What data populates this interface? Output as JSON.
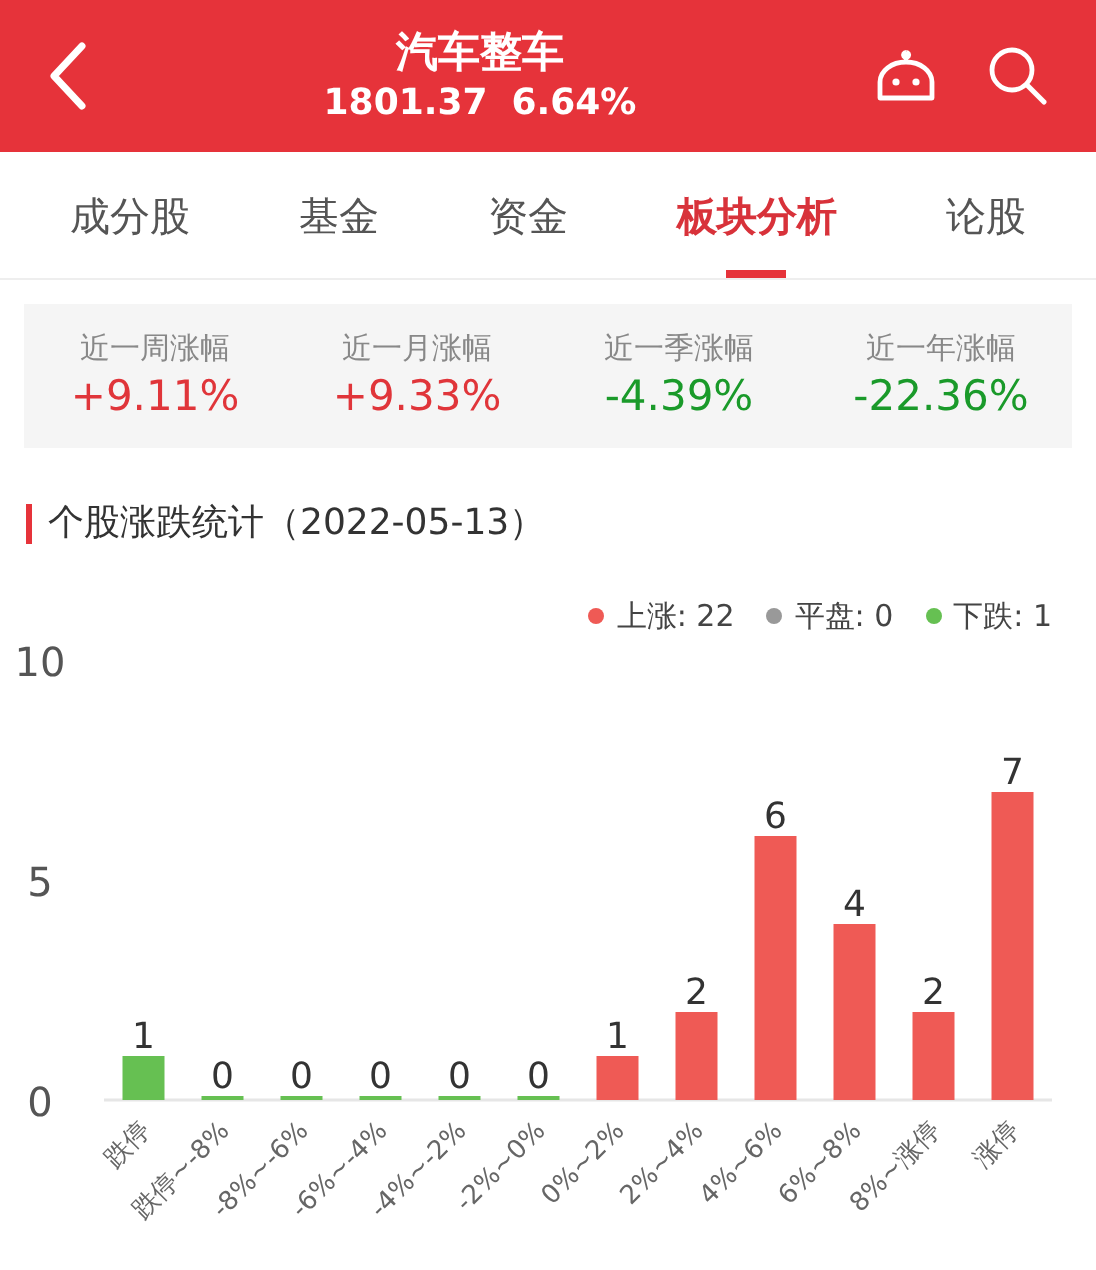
{
  "header": {
    "title": "汽车整车",
    "price": "1801.37",
    "change": "6.64%"
  },
  "tabs": [
    {
      "label": "成分股",
      "selected": false
    },
    {
      "label": "基金",
      "selected": false
    },
    {
      "label": "资金",
      "selected": false
    },
    {
      "label": "板块分析",
      "selected": true
    },
    {
      "label": "论股",
      "selected": false
    }
  ],
  "stats": [
    {
      "label": "近一周涨幅",
      "value": "+9.11%",
      "rising": true
    },
    {
      "label": "近一月涨幅",
      "value": "+9.33%",
      "rising": true
    },
    {
      "label": "近一季涨幅",
      "value": "-4.39%",
      "rising": false
    },
    {
      "label": "近一年涨幅",
      "value": "-22.36%",
      "rising": false
    }
  ],
  "section_title": "个股涨跌统计（2022-05-13）",
  "legend": [
    {
      "label": "上涨: 22",
      "color": "#ef5a55"
    },
    {
      "label": "平盘: 0",
      "color": "#999999"
    },
    {
      "label": "下跌: 1",
      "color": "#66c052"
    }
  ],
  "chart_data": {
    "type": "bar",
    "categories": [
      "跌停",
      "跌停~-8%",
      "-8%~-6%",
      "-6%~-4%",
      "-4%~-2%",
      "-2%~0%",
      "0%~2%",
      "2%~4%",
      "4%~6%",
      "6%~8%",
      "8%~涨停",
      "涨停"
    ],
    "series": [
      {
        "color": "#66c052",
        "values": [
          1,
          0,
          0,
          0,
          0,
          0,
          null,
          null,
          null,
          null,
          null,
          null
        ]
      },
      {
        "color": "#ef5a55",
        "values": [
          null,
          null,
          null,
          null,
          null,
          null,
          1,
          2,
          6,
          4,
          2,
          7
        ]
      }
    ],
    "stacked": true,
    "ylim": [
      0,
      10
    ],
    "yticks": [
      0,
      5,
      10
    ],
    "data_labels": true
  }
}
